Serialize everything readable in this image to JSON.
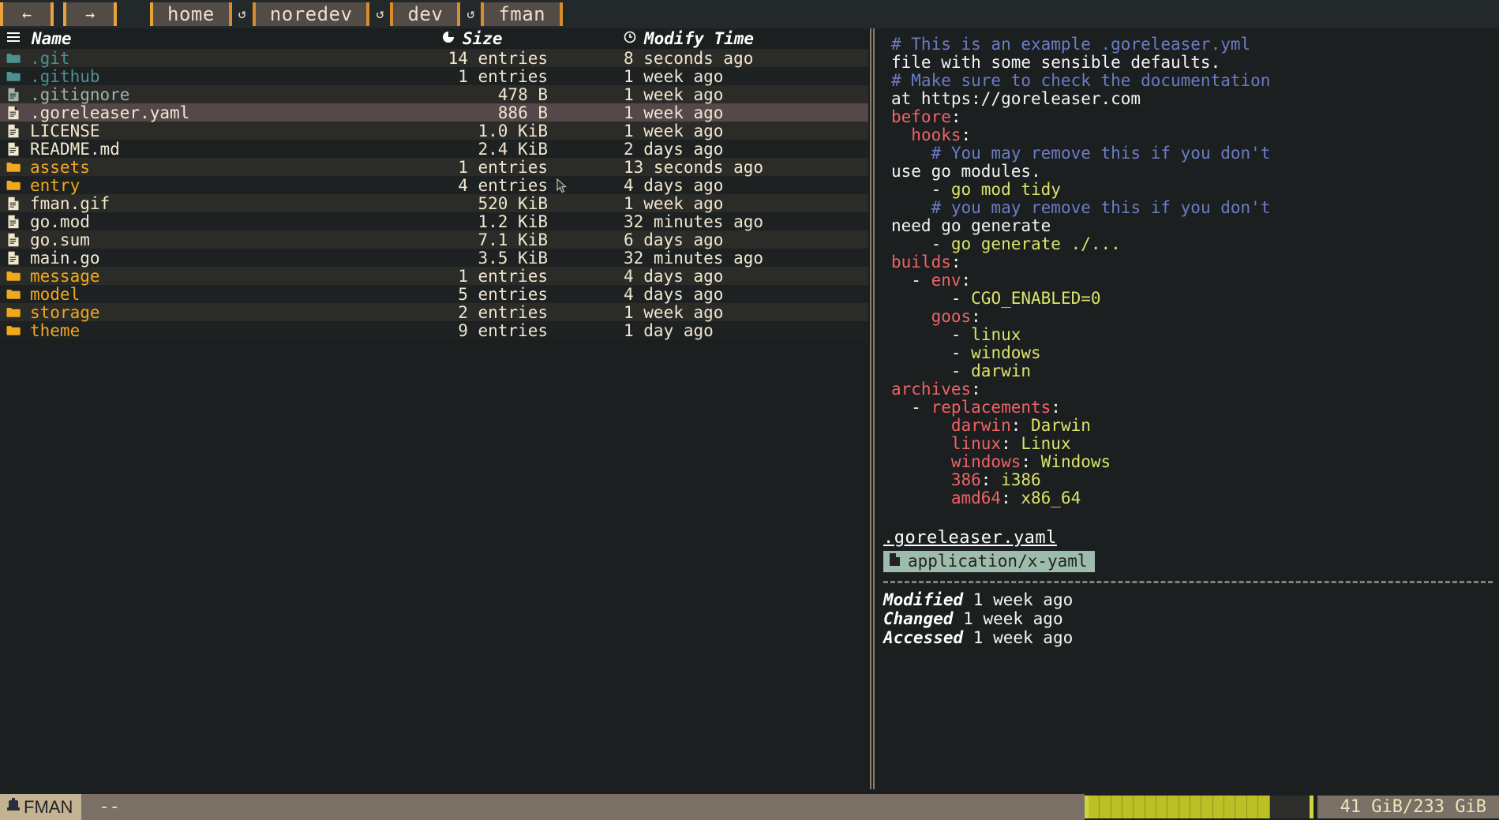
{
  "topbar": {
    "back_label": "←",
    "forward_label": "→",
    "crumb_icon": "↺",
    "crumbs": [
      {
        "label": "home"
      },
      {
        "label": "noredev"
      },
      {
        "label": "dev"
      },
      {
        "label": "fman"
      }
    ]
  },
  "filelist": {
    "headers": {
      "name": "Name",
      "size": "Size",
      "time": "Modify Time",
      "name_icon": "list-icon",
      "size_icon": "pie-icon",
      "time_icon": "clock-icon"
    },
    "rows": [
      {
        "name": ".git",
        "size": "14 entries",
        "time": "8 seconds ago",
        "kind": "hid-dir",
        "selected": false
      },
      {
        "name": ".github",
        "size": "1 entries",
        "time": "1 week ago",
        "kind": "hid-dir",
        "selected": false
      },
      {
        "name": ".gitignore",
        "size": "478 B",
        "time": "1 week ago",
        "kind": "hid-file",
        "selected": false
      },
      {
        "name": ".goreleaser.yaml",
        "size": "886 B",
        "time": "1 week ago",
        "kind": "file",
        "selected": true
      },
      {
        "name": "LICENSE",
        "size": "1.0 KiB",
        "time": "1 week ago",
        "kind": "file",
        "selected": false
      },
      {
        "name": "README.md",
        "size": "2.4 KiB",
        "time": "2 days ago",
        "kind": "file",
        "selected": false
      },
      {
        "name": "assets",
        "size": "1 entries",
        "time": "13 seconds ago",
        "kind": "dir",
        "selected": false
      },
      {
        "name": "entry",
        "size": "4 entries",
        "time": "4 days ago",
        "kind": "dir",
        "selected": false
      },
      {
        "name": "fman.gif",
        "size": "520 KiB",
        "time": "1 week ago",
        "kind": "file",
        "selected": false
      },
      {
        "name": "go.mod",
        "size": "1.2 KiB",
        "time": "32 minutes ago",
        "kind": "file",
        "selected": false
      },
      {
        "name": "go.sum",
        "size": "7.1 KiB",
        "time": "6 days ago",
        "kind": "file",
        "selected": false
      },
      {
        "name": "main.go",
        "size": "3.5 KiB",
        "time": "32 minutes ago",
        "kind": "file",
        "selected": false
      },
      {
        "name": "message",
        "size": "1 entries",
        "time": "4 days ago",
        "kind": "dir",
        "selected": false
      },
      {
        "name": "model",
        "size": "5 entries",
        "time": "4 days ago",
        "kind": "dir",
        "selected": false
      },
      {
        "name": "storage",
        "size": "2 entries",
        "time": "1 week ago",
        "kind": "dir",
        "selected": false
      },
      {
        "name": "theme",
        "size": "9 entries",
        "time": "1 day ago",
        "kind": "dir",
        "selected": false
      }
    ]
  },
  "preview": {
    "lines": [
      [
        {
          "t": "c",
          "s": "# This is an example .goreleaser.yml"
        }
      ],
      [
        {
          "t": "p",
          "s": "file with some sensible defaults."
        }
      ],
      [
        {
          "t": "c",
          "s": "# Make sure to check the documentation"
        }
      ],
      [
        {
          "t": "p",
          "s": "at https://goreleaser.com"
        }
      ],
      [
        {
          "t": "k",
          "s": "before"
        },
        {
          "t": "p",
          "s": ":"
        }
      ],
      [
        {
          "t": "p",
          "s": "  "
        },
        {
          "t": "k",
          "s": "hooks"
        },
        {
          "t": "p",
          "s": ":"
        }
      ],
      [
        {
          "t": "p",
          "s": "    "
        },
        {
          "t": "c",
          "s": "# You may remove this if you don't"
        }
      ],
      [
        {
          "t": "p",
          "s": "use go modules."
        }
      ],
      [
        {
          "t": "p",
          "s": "    - "
        },
        {
          "t": "v",
          "s": "go mod tidy"
        }
      ],
      [
        {
          "t": "p",
          "s": "    "
        },
        {
          "t": "c",
          "s": "# you may remove this if you don't"
        }
      ],
      [
        {
          "t": "p",
          "s": "need go generate"
        }
      ],
      [
        {
          "t": "p",
          "s": "    - "
        },
        {
          "t": "v",
          "s": "go generate ./..."
        }
      ],
      [
        {
          "t": "k",
          "s": "builds"
        },
        {
          "t": "p",
          "s": ":"
        }
      ],
      [
        {
          "t": "p",
          "s": "  - "
        },
        {
          "t": "k",
          "s": "env"
        },
        {
          "t": "p",
          "s": ":"
        }
      ],
      [
        {
          "t": "p",
          "s": "      - "
        },
        {
          "t": "v",
          "s": "CGO_ENABLED=0"
        }
      ],
      [
        {
          "t": "p",
          "s": "    "
        },
        {
          "t": "k",
          "s": "goos"
        },
        {
          "t": "p",
          "s": ":"
        }
      ],
      [
        {
          "t": "p",
          "s": "      - "
        },
        {
          "t": "v",
          "s": "linux"
        }
      ],
      [
        {
          "t": "p",
          "s": "      - "
        },
        {
          "t": "v",
          "s": "windows"
        }
      ],
      [
        {
          "t": "p",
          "s": "      - "
        },
        {
          "t": "v",
          "s": "darwin"
        }
      ],
      [
        {
          "t": "k",
          "s": "archives"
        },
        {
          "t": "p",
          "s": ":"
        }
      ],
      [
        {
          "t": "p",
          "s": "  - "
        },
        {
          "t": "k",
          "s": "replacements"
        },
        {
          "t": "p",
          "s": ":"
        }
      ],
      [
        {
          "t": "p",
          "s": "      "
        },
        {
          "t": "k",
          "s": "darwin"
        },
        {
          "t": "p",
          "s": ": "
        },
        {
          "t": "v",
          "s": "Darwin"
        }
      ],
      [
        {
          "t": "p",
          "s": "      "
        },
        {
          "t": "k",
          "s": "linux"
        },
        {
          "t": "p",
          "s": ": "
        },
        {
          "t": "v",
          "s": "Linux"
        }
      ],
      [
        {
          "t": "p",
          "s": "      "
        },
        {
          "t": "k",
          "s": "windows"
        },
        {
          "t": "p",
          "s": ": "
        },
        {
          "t": "v",
          "s": "Windows"
        }
      ],
      [
        {
          "t": "p",
          "s": "      "
        },
        {
          "t": "k",
          "s": "386"
        },
        {
          "t": "p",
          "s": ": "
        },
        {
          "t": "v",
          "s": "i386"
        }
      ],
      [
        {
          "t": "p",
          "s": "      "
        },
        {
          "t": "k",
          "s": "amd64"
        },
        {
          "t": "p",
          "s": ": "
        },
        {
          "t": "v",
          "s": "x86_64"
        }
      ]
    ],
    "meta": {
      "filename": ".goreleaser.yaml",
      "mime": "application/x-yaml",
      "mime_icon": "file-icon",
      "modified_label": "Modified",
      "modified_value": " 1 week ago",
      "changed_label": "Changed",
      "changed_value": " 1 week ago",
      "accessed_label": "Accessed",
      "accessed_value": " 1 week ago"
    }
  },
  "status": {
    "brand": "FMAN",
    "brand_icon": "hat-icon",
    "message": "--",
    "disk_text": "41 GiB/233 GiB",
    "disk_percent": 82
  },
  "colors": {
    "accent_orange": "#e8a33d",
    "dir": "#f0a81e",
    "file": "#f2e8ce",
    "hidden": "#4e8f90",
    "yaml_key": "#ef6265",
    "yaml_value": "#dbe46a",
    "yaml_comment": "#6b7cc4",
    "selection": "#55484a",
    "progress": "#bcc025"
  }
}
